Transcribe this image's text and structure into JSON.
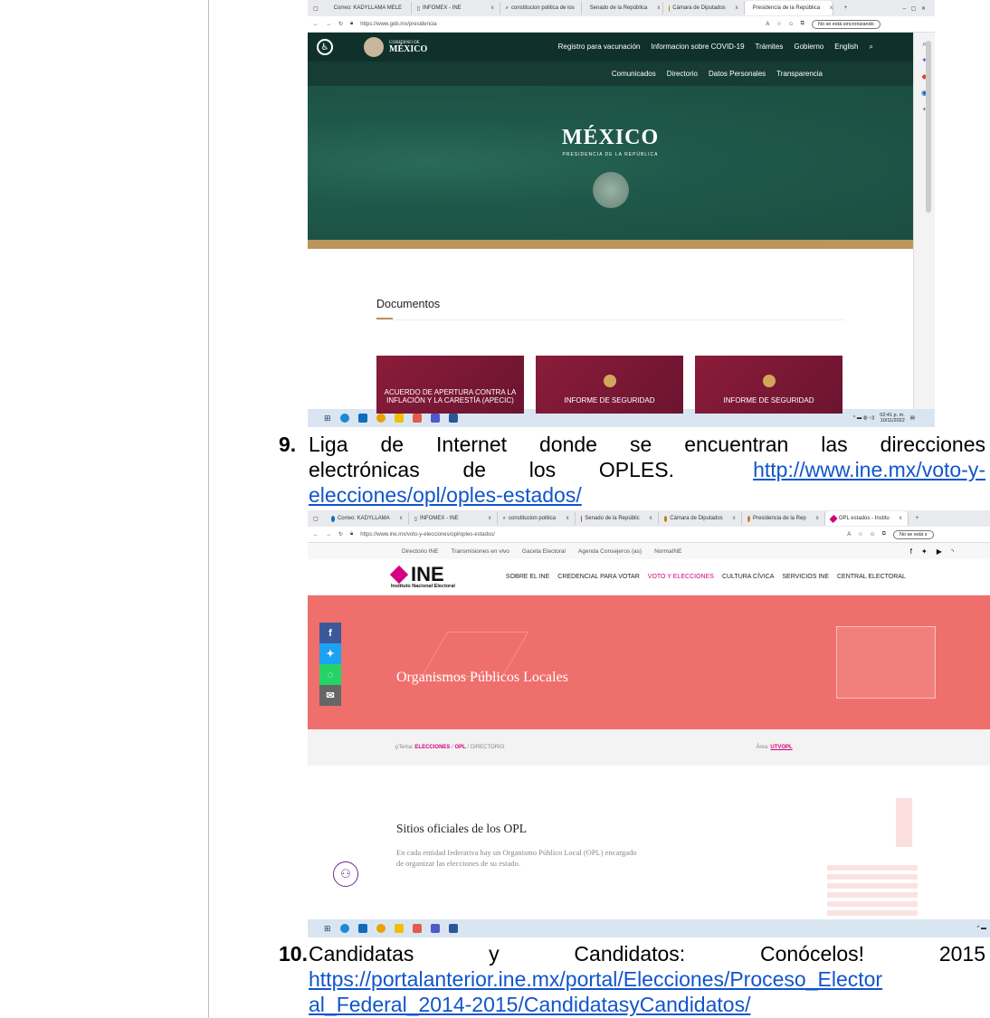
{
  "shot1": {
    "tabs": [
      {
        "label": "Correo: KADYLLAMA MELE",
        "close": "x"
      },
      {
        "label": "INFOMEX - INE",
        "close": "x"
      },
      {
        "label": "constitucion politica de los",
        "close": "x"
      },
      {
        "label": "Senado de la República",
        "close": "x"
      },
      {
        "label": "Cámara de Diputados",
        "close": "x"
      },
      {
        "label": "Presidencia de la República",
        "close": "x"
      }
    ],
    "new_tab": "+",
    "win_controls": "–   ▢   ✕",
    "url": "https://www.gob.mx/presidencia",
    "sync": "No se está sincronizando",
    "logo_top": "GOBIERNO DE",
    "logo_bottom": "MÉXICO",
    "nav": [
      "Registro para vacunación",
      "Informacion sobre COVID-19",
      "Trámites",
      "Gobierno",
      "English"
    ],
    "subnav": [
      "Comunicados",
      "Directorio",
      "Datos Personales",
      "Transparencia"
    ],
    "hero_title": "MÉXICO",
    "hero_sub": "PRESIDENCIA DE LA REPÚBLICA",
    "section_title": "Documentos",
    "cards": [
      {
        "line1": "ACUERDO DE APERTURA CONTRA LA",
        "line2": "INFLACIÓN Y LA CARESTÍA (APECIC)"
      },
      {
        "line1": "INFORME DE SEGURIDAD",
        "line2": ""
      },
      {
        "line1": "INFORME DE SEGURIDAD",
        "line2": ""
      }
    ],
    "clock_time": "02:41 p. m.",
    "clock_date": "10/11/2022"
  },
  "item9": {
    "number": "9.",
    "line1": "Liga de Internet donde se encuentran las direcciones",
    "line2_text": "electrónicas de los OPLES.",
    "link_part1": "http://www.ine.mx/voto-y-",
    "link_part2": "elecciones/opl/oples-estados/"
  },
  "shot2": {
    "tabs": [
      {
        "label": "Correo: KADYLLAMA",
        "close": "x"
      },
      {
        "label": "INFOMEX - INE",
        "close": "x"
      },
      {
        "label": "constitucion politica",
        "close": "x"
      },
      {
        "label": "Senado de la Repúblic",
        "close": "x"
      },
      {
        "label": "Cámara de Diputados",
        "close": "x"
      },
      {
        "label": "Presidencia de la Rep",
        "close": "x"
      },
      {
        "label": "OPL estados - Institu",
        "close": "x"
      }
    ],
    "new_tab": "+",
    "url": "https://www.ine.mx/voto-y-elecciones/opl/oples-estados/",
    "sync": "No se está s",
    "util": [
      "Directorio INE",
      "Transmisiones en vivo",
      "Gaceta Electoral",
      "Agenda Consejeros (as)",
      "NormaINE"
    ],
    "logo": "INE",
    "logo_sub": "Instituto Nacional Electoral",
    "menu": [
      "SOBRE EL INE",
      "CREDENCIAL PARA VOTAR",
      "VOTO Y ELECCIONES",
      "CULTURA CÍVICA",
      "SERVICIOS INE",
      "CENTRAL ELECTORAL"
    ],
    "hero_title": "Organismos Públicos Locales",
    "crumb_prefix": "Tema:",
    "crumb_a": "ELECCIONES",
    "crumb_b": "OPL",
    "crumb_c": "DIRECTORIO",
    "area_label": "Área:",
    "area_value": "UTVOPL",
    "body_title": "Sitios oficiales de los OPL",
    "body_text1": "En cada entidad federativa hay un Organismo Público Local (OPL) encargado",
    "body_text2": "de organizar las elecciones de su estado."
  },
  "item10": {
    "number": "10.",
    "line1": "Candidatas y Candidatos: Conócelos! 2015",
    "link_part1": "https://portalanterior.ine.mx/portal/Elecciones/Proceso_Elector",
    "link_part2": "al_Federal_2014-2015/CandidatasyCandidatos/"
  },
  "colors": {
    "gob_green": "#10312b",
    "gold": "#bc955c",
    "ine_magenta": "#d5007f",
    "ine_coral": "#ef6f6c",
    "link": "#1155cc"
  }
}
